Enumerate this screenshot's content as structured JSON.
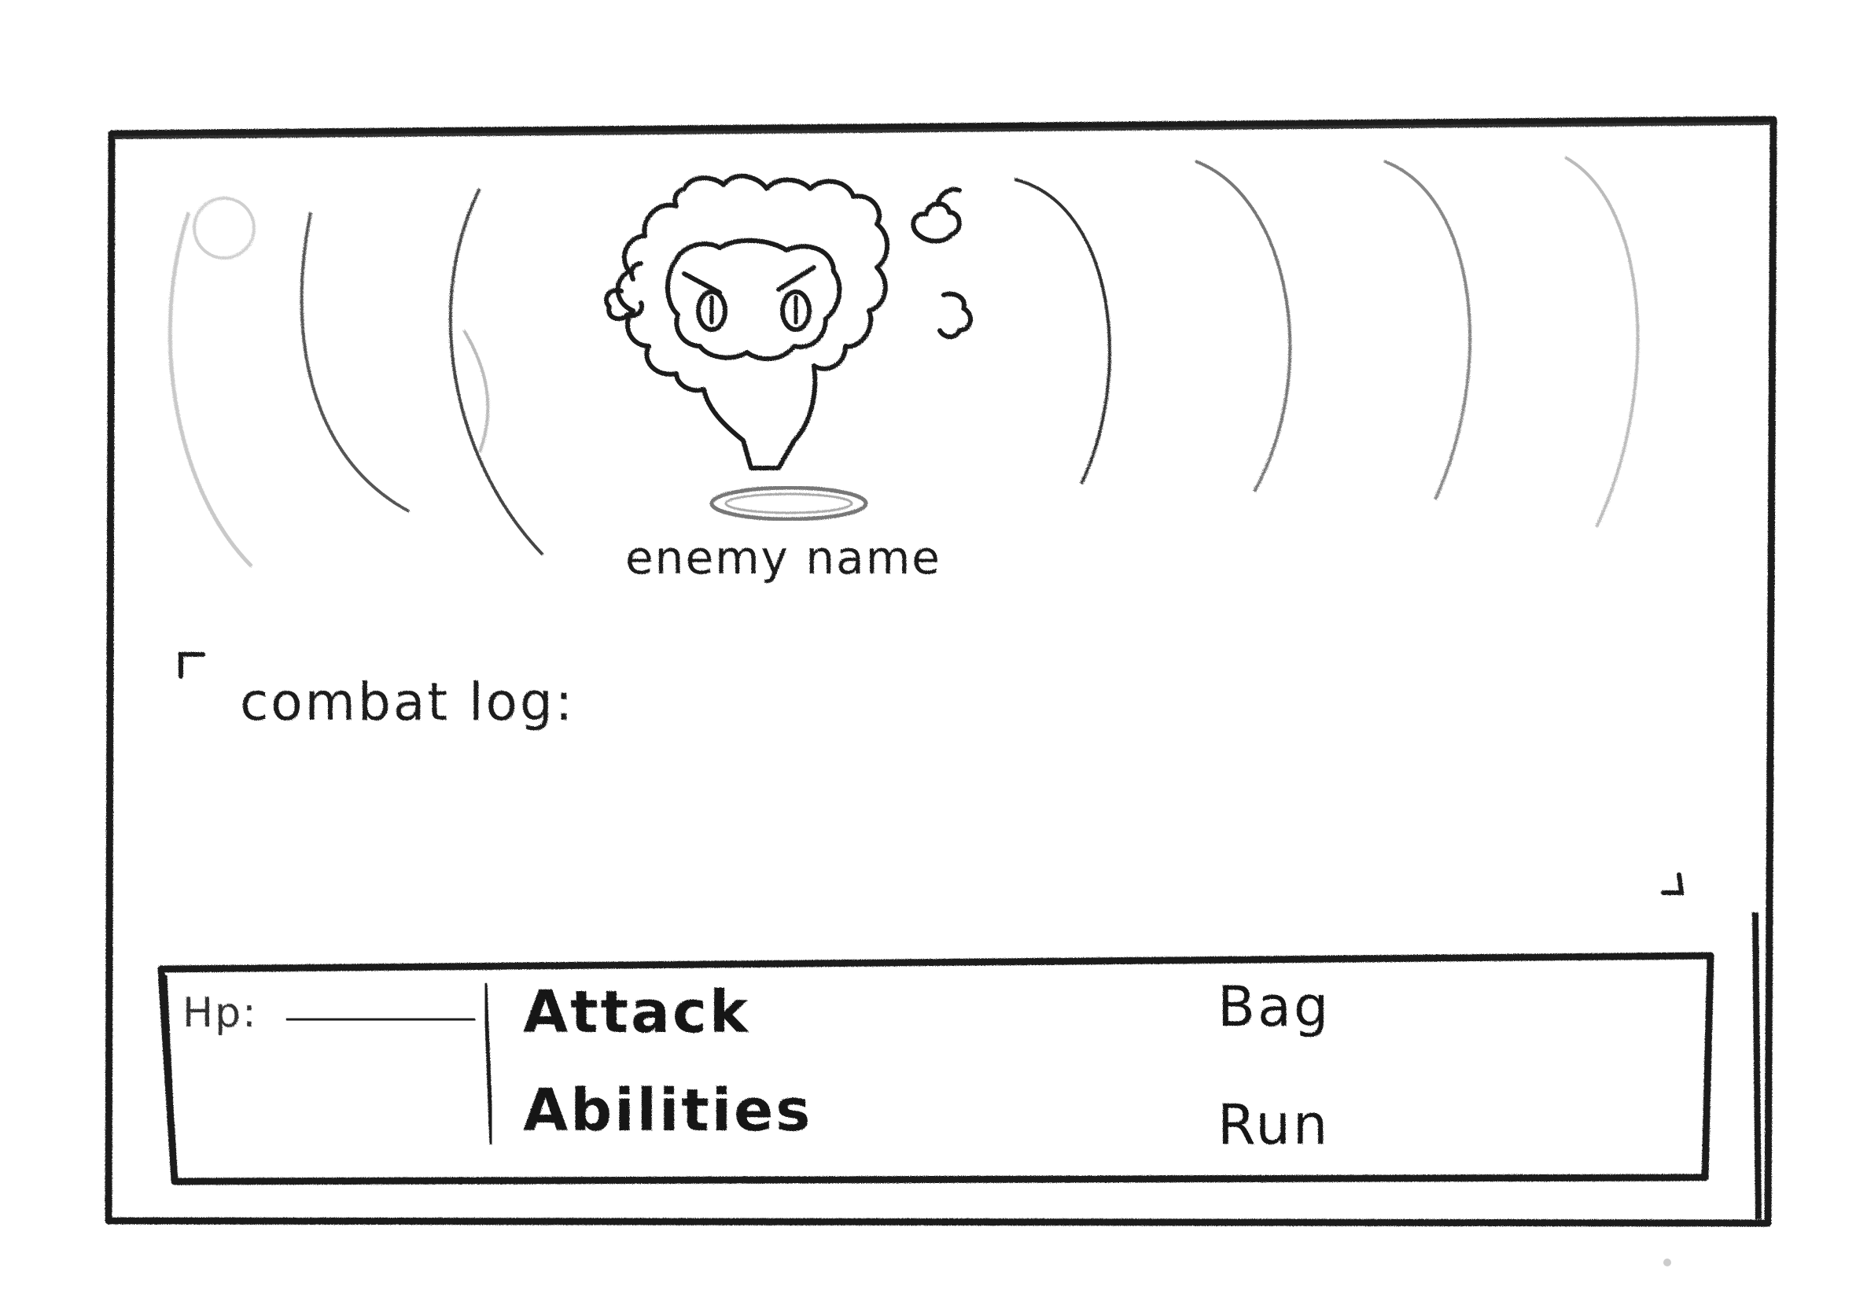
{
  "enemy": {
    "name": "enemy name"
  },
  "combat_log": {
    "label": "combat log:",
    "entries": []
  },
  "player": {
    "hp_label": "Hp:"
  },
  "menu": {
    "attack_label": "Attack",
    "abilities_label": "Abilities",
    "bag_label": "Bag",
    "run_label": "Run"
  },
  "colors": {
    "ink": "#1c1c1c",
    "faint_ink": "#9a9a9a",
    "paper": "#ffffff"
  },
  "icons": {
    "enemy_sprite": "angry-fluffy-creature-icon",
    "enemy_platform": "oval-platform-icon",
    "log_scroll_corner": "scroll-corner-icon"
  }
}
